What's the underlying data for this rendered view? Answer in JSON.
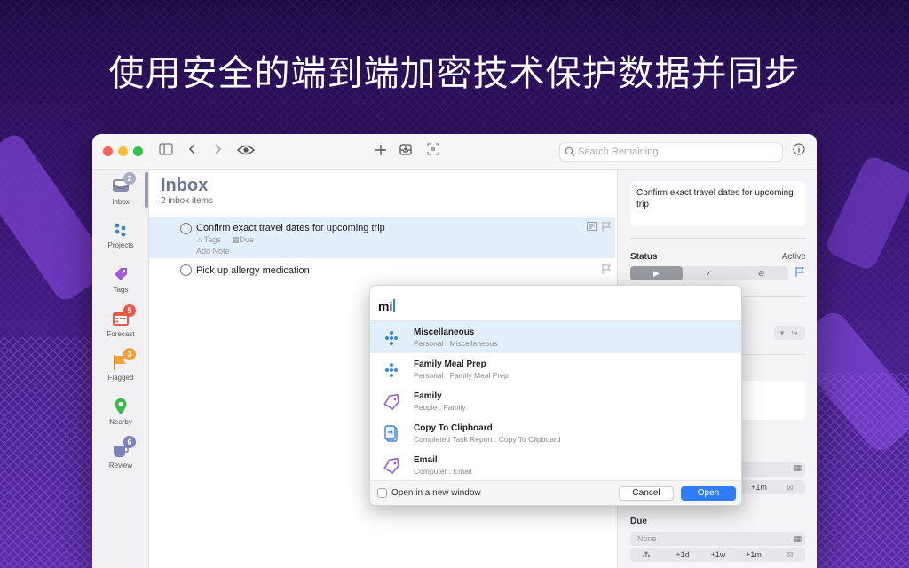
{
  "banner": {
    "text": "使用安全的端到端加密技术保护数据并同步"
  },
  "colors": {
    "accent": "#2f7cf6",
    "inbox_title": "#6b7597",
    "forecast_badge": "#e8584b",
    "flagged_badge": "#f0a13a",
    "review_badge": "#7b83b7"
  },
  "toolbar": {
    "search_placeholder": "Search Remaining"
  },
  "sidebar": {
    "items": [
      {
        "label": "Inbox",
        "badge": "2",
        "icon": "inbox-icon"
      },
      {
        "label": "Projects",
        "badge": "",
        "icon": "projects-icon"
      },
      {
        "label": "Tags",
        "badge": "",
        "icon": "tag-icon"
      },
      {
        "label": "Forecast",
        "badge": "5",
        "icon": "calendar-icon"
      },
      {
        "label": "Flagged",
        "badge": "3",
        "icon": "flag-icon"
      },
      {
        "label": "Nearby",
        "badge": "",
        "icon": "location-pin-icon"
      },
      {
        "label": "Review",
        "badge": "6",
        "icon": "review-icon"
      }
    ]
  },
  "main": {
    "title": "Inbox",
    "subtitle": "2 inbox items",
    "tasks": [
      {
        "title": "Confirm exact travel dates for upcoming trip",
        "tags": "Tags",
        "due": "Due",
        "note": "Add Note"
      },
      {
        "title": "Pick up allergy medication"
      }
    ]
  },
  "inspector": {
    "note": "Confirm exact travel dates for upcoming trip",
    "status_label": "Status",
    "status_value": "Active",
    "due_label": "Due",
    "due_placeholder": "None",
    "plus1m": "+1m",
    "quick": [
      "+1d",
      "+1w",
      "+1m"
    ]
  },
  "popup": {
    "query": "mi",
    "results": [
      {
        "title": "Miscellaneous",
        "subtitle": "Personal : Miscellaneous",
        "icon": "project-icon"
      },
      {
        "title": "Family Meal Prep",
        "subtitle": "Personal : Family Meal Prep",
        "icon": "project-icon"
      },
      {
        "title": "Family",
        "subtitle": "People : Family",
        "icon": "tag-icon"
      },
      {
        "title": "Copy To Clipboard",
        "subtitle": "Completed Task Report : Copy To Clipboard",
        "icon": "clipboard-icon"
      },
      {
        "title": "Email",
        "subtitle": "Computer : Email",
        "icon": "tag-icon"
      }
    ],
    "checkbox_label": "Open in a new window",
    "cancel": "Cancel",
    "open": "Open"
  }
}
